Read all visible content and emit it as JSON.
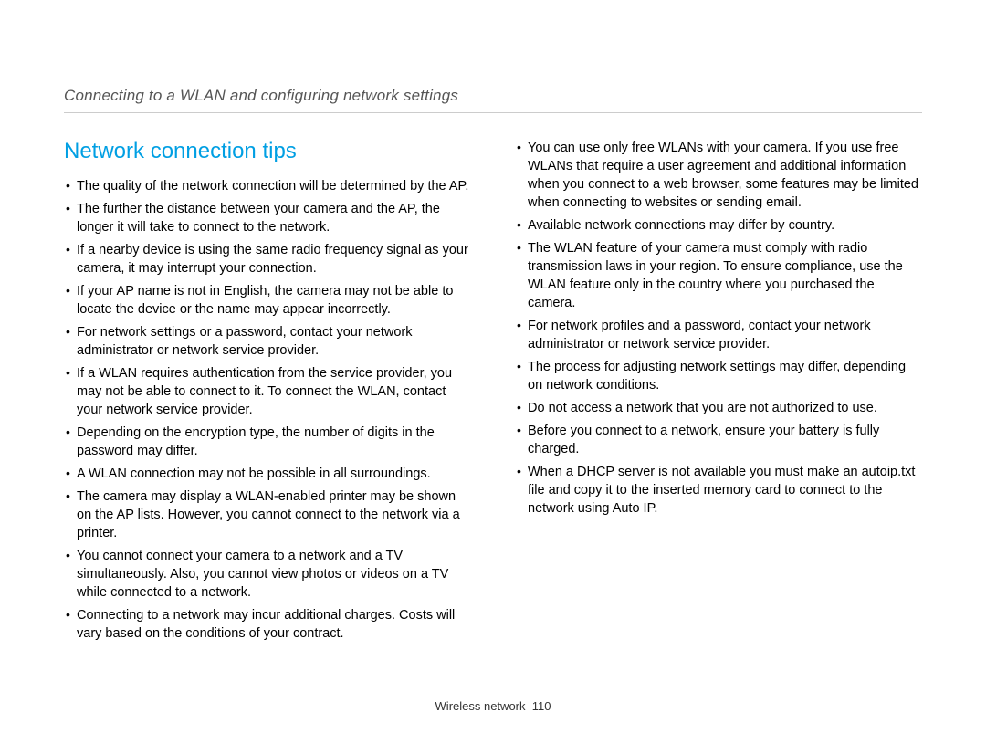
{
  "header": {
    "breadcrumb": "Connecting to a WLAN and configuring network settings"
  },
  "section": {
    "heading": "Network connection tips"
  },
  "column_left": {
    "items": [
      "The quality of the network connection will be determined by the AP.",
      "The further the distance between your camera and the AP, the longer it will take to connect to the network.",
      "If a nearby device is using the same radio frequency signal as your camera, it may interrupt your connection.",
      "If your AP name is not in English, the camera may not be able to locate the device or the name may appear incorrectly.",
      "For network settings or a password, contact your network administrator or network service provider.",
      "If a WLAN requires authentication from the service provider, you may not be able to connect to it. To connect the WLAN, contact your network service provider.",
      "Depending on the encryption type, the number of digits in the password may differ.",
      "A WLAN connection may not be possible in all surroundings.",
      "The camera may display a WLAN-enabled printer may be shown on the AP lists. However, you cannot connect to the network via a printer.",
      "You cannot connect your camera to a network and a TV simultaneously. Also, you cannot view photos or videos on a TV while connected to a network.",
      "Connecting to a network may incur additional charges. Costs will vary based on the conditions of your contract."
    ]
  },
  "column_right": {
    "items": [
      "You can use only free WLANs with your camera. If you use free WLANs that require a user agreement and additional information when you connect to a web browser, some features may be limited when connecting to websites or sending email.",
      "Available network connections may differ by country.",
      "The WLAN feature of your camera must comply with radio transmission laws in your region. To ensure compliance, use the WLAN feature only in the country where you purchased the camera.",
      "For network profiles and a password, contact your network administrator or network service provider.",
      "The process for adjusting network settings may differ, depending on network conditions.",
      "Do not access a network that you are not authorized to use.",
      "Before you connect to a network, ensure your battery is fully charged.",
      "When a DHCP server is not available you must make an autoip.txt file and copy it to the inserted memory card to connect to the network using Auto IP."
    ]
  },
  "footer": {
    "section_label": "Wireless network",
    "page_number": "110"
  }
}
